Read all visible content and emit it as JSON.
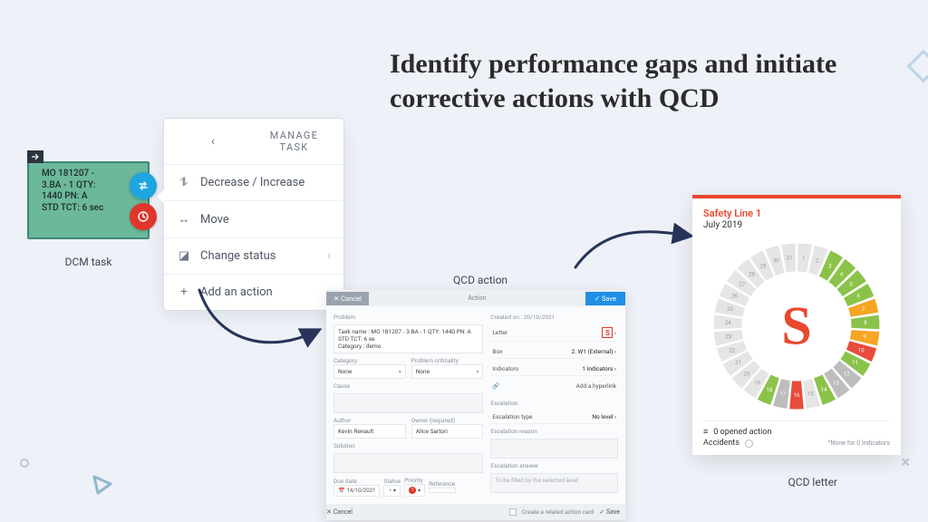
{
  "headline": "Identify performance gaps and initiate corrective actions with QCD",
  "dcm": {
    "text": "MO 181207 -\n3.BA - 1 QTY:\n1440 PN: A\nSTD TCT: 6 sec",
    "label": "DCM task",
    "swap_icon": "swap-icon",
    "clock_icon": "clock-icon"
  },
  "menu": {
    "header": "MANAGE TASK",
    "items": [
      {
        "icon": "resize-icon",
        "glyph": "⥮",
        "label": "Decrease / Increase",
        "chev": false
      },
      {
        "icon": "move-icon",
        "glyph": "↔",
        "label": "Move",
        "chev": false
      },
      {
        "icon": "status-icon",
        "glyph": "◪",
        "label": "Change status",
        "chev": true
      },
      {
        "icon": "plus-icon",
        "glyph": "+",
        "label": "Add an action",
        "chev": true
      }
    ]
  },
  "qcd_caption": "QCD action",
  "letter_caption": "QCD letter",
  "qcd": {
    "cancel": "✕ Cancel",
    "title": "Action",
    "save": "✓ Save",
    "problem_label": "Problem",
    "problem_text": "Task name : MO 181207 - 3.BA - 1 QTY: 1440 PN: A STD TCT: 6 se\nCategory : demo",
    "category_label": "Category",
    "category_value": "None",
    "criticity_label": "Problem criticality",
    "criticity_value": "None",
    "cause_label": "Cause",
    "author_label": "Author",
    "author_value": "Kevin Renault",
    "owner_label": "Owner (required)",
    "owner_value": "Alice Sartori",
    "solution_label": "Solution",
    "due_label": "Due date",
    "due_value": "14/10/2021",
    "status_label": "Status",
    "priority_label": "Priority",
    "priority_value": "1",
    "reference_label": "Reference",
    "created_label": "Created on : 20/10/2021",
    "kv_letter": "Letter",
    "kv_letter_v": "S",
    "kv_box": "Box",
    "kv_box_v": "2. W1 (External)",
    "kv_ind": "Indicators",
    "kv_ind_v": "1 Indicators",
    "hyperlink": "Add a hyperlink",
    "escalation_label": "Escalation",
    "esc_type": "Escalation type",
    "esc_type_v": "No level",
    "esc_reason": "Escalation reason",
    "esc_answer": "Escalation answer",
    "esc_answer_ph": "To be filled by the selected level",
    "related": "Create a related action card"
  },
  "letter": {
    "title": "Safety Line 1",
    "sub": "July 2019",
    "center": "S",
    "opened": "0 opened action",
    "accidents": "Accidents",
    "none": "*None for 0 Indicators",
    "segments": [
      {
        "n": 1,
        "c": "#e5e5e5"
      },
      {
        "n": 2,
        "c": "#e5e5e5"
      },
      {
        "n": 3,
        "c": "#8bc34a"
      },
      {
        "n": 4,
        "c": "#8bc34a"
      },
      {
        "n": 5,
        "c": "#8bc34a"
      },
      {
        "n": 6,
        "c": "#8bc34a"
      },
      {
        "n": 7,
        "c": "#f5a623"
      },
      {
        "n": 8,
        "c": "#8bc34a"
      },
      {
        "n": 9,
        "c": "#f5a623"
      },
      {
        "n": 10,
        "c": "#e74c3c"
      },
      {
        "n": 11,
        "c": "#8bc34a"
      },
      {
        "n": 12,
        "c": "#bdbdbd"
      },
      {
        "n": 13,
        "c": "#bdbdbd"
      },
      {
        "n": 14,
        "c": "#8bc34a"
      },
      {
        "n": 15,
        "c": "#e5e5e5"
      },
      {
        "n": 16,
        "c": "#e74c3c"
      },
      {
        "n": 17,
        "c": "#bdbdbd"
      },
      {
        "n": 18,
        "c": "#8bc34a"
      },
      {
        "n": 19,
        "c": "#e5e5e5"
      },
      {
        "n": 20,
        "c": "#e5e5e5"
      },
      {
        "n": 21,
        "c": "#e5e5e5"
      },
      {
        "n": 22,
        "c": "#e5e5e5"
      },
      {
        "n": 23,
        "c": "#e5e5e5"
      },
      {
        "n": 24,
        "c": "#e5e5e5"
      },
      {
        "n": 25,
        "c": "#e5e5e5"
      },
      {
        "n": 26,
        "c": "#e5e5e5"
      },
      {
        "n": 27,
        "c": "#e5e5e5"
      },
      {
        "n": 28,
        "c": "#e5e5e5"
      },
      {
        "n": 29,
        "c": "#e5e5e5"
      },
      {
        "n": 30,
        "c": "#e5e5e5"
      },
      {
        "n": 31,
        "c": "#e5e5e5"
      }
    ]
  }
}
